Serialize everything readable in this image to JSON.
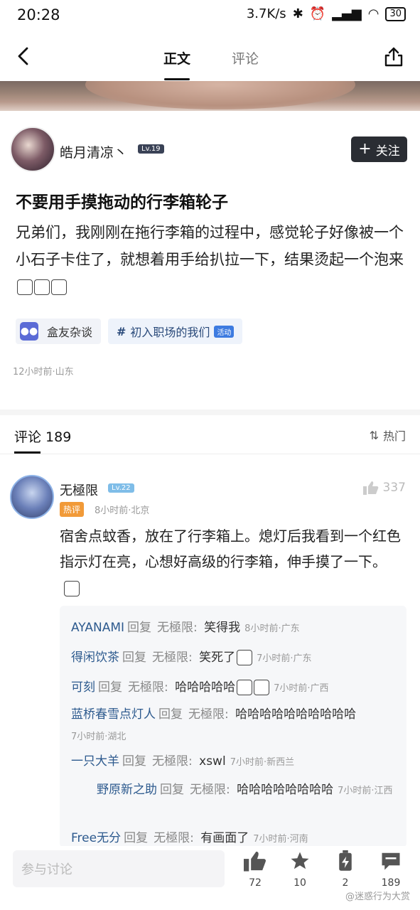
{
  "status": {
    "time": "20:28",
    "network": "3.7K/s",
    "battery": "30"
  },
  "nav": {
    "tab_main": "正文",
    "tab_comments": "评论"
  },
  "post": {
    "author": "皓月清凉丶",
    "level": "Lv.19",
    "follow_label": "关注",
    "title": "不要用手摸拖动的行李箱轮子",
    "body": "兄弟们，我刚刚在拖行李箱的过程中，感觉轮子好像被一个小石子卡住了，就想着用手给扒拉一下，结果烫起一个泡来",
    "tags": [
      {
        "label": "盒友杂谈"
      },
      {
        "label": "初入职场的我们",
        "badge": "活动"
      }
    ],
    "meta": "12小时前·山东"
  },
  "comments": {
    "header": "评论 189",
    "sort_label": "热门",
    "top": {
      "name": "无極限",
      "level": "Lv.22",
      "likes": "337",
      "hot_badge": "热评",
      "meta": "8小时前·北京",
      "body": "宿舍点蚊香，放在了行李箱上。熄灯后我看到一个红色指示灯在亮，心想好高级的行李箱，伸手摸了一下。"
    },
    "replies": [
      {
        "name": "AYANAMI",
        "reply": "回复",
        "to": "无極限:",
        "text": "笑得我",
        "time": "8小时前·广东"
      },
      {
        "name": "得闲饮茶",
        "reply": "回复",
        "to": "无極限:",
        "text": "笑死了",
        "time": "7小时前·广东"
      },
      {
        "name": "可刻",
        "reply": "回复",
        "to": "无極限:",
        "text": "哈哈哈哈哈",
        "time": "7小时前·广西"
      },
      {
        "name": "蓝桥春雪点灯人",
        "reply": "回复",
        "to": "无極限:",
        "text": "哈哈哈哈哈哈哈哈哈哈",
        "time": "7小时前·湖北"
      },
      {
        "name": "一只大羊",
        "reply": "回复",
        "to": "无極限:",
        "text": "xswl",
        "time": "7小时前·新西兰"
      },
      {
        "name": "野原新之助",
        "reply": "回复",
        "to": "无極限:",
        "text": "哈哈哈哈哈哈哈哈",
        "time": "7小时前·江西"
      },
      {
        "name": "Free无分",
        "reply": "回复",
        "to": "无極限:",
        "text": "有画面了",
        "time": "7小时前·河南"
      }
    ]
  },
  "bottom": {
    "input_placeholder": "参与讨论",
    "likes": "72",
    "favorites": "10",
    "charge": "2",
    "comments": "189"
  },
  "watermark": "@迷惑行为大赏"
}
